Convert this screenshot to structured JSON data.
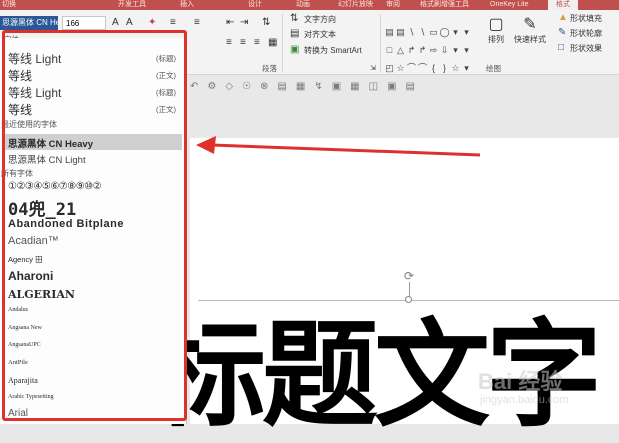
{
  "tabs": [
    {
      "label": "切换",
      "active": false
    },
    {
      "label": "开发工具",
      "active": false
    },
    {
      "label": "插入",
      "active": false
    },
    {
      "label": "设计",
      "active": false
    },
    {
      "label": "动画",
      "active": false
    },
    {
      "label": "幻灯片放映",
      "active": false
    },
    {
      "label": "审阅",
      "active": false
    },
    {
      "label": "格式刷增强工具",
      "active": false
    },
    {
      "label": "OneKey Lite",
      "active": false
    },
    {
      "label": "格式",
      "active": true
    }
  ],
  "ribbon": {
    "font_name": "思源黑体 CN He",
    "font_size": "166",
    "text_direction": "文字方向",
    "align_text": "对齐文本",
    "convert_smartart": "转换为 SmartArt",
    "paragraph_group": "段落",
    "drawing_group": "绘图",
    "arrange": "排列",
    "quick_styles": "快速样式",
    "shape_fill": "形状填充",
    "shape_outline": "形状轮廓",
    "shape_effects": "形状效果",
    "font_group_partial": "字体"
  },
  "font_panel": {
    "theme_fonts": [
      {
        "name": "等线 Light",
        "tag": "(标题)"
      },
      {
        "name": "等线",
        "tag": "(正文)"
      },
      {
        "name": "等线 Light",
        "tag": "(标题)"
      },
      {
        "name": "等线",
        "tag": "(正文)"
      }
    ],
    "recent_header": "最近使用的字体",
    "recent_fonts": [
      "思源黑体 CN Heavy",
      "思源黑体 CN Light"
    ],
    "all_header": "所有字体",
    "all_fonts": [
      "①②③④⑤⑥⑦⑧⑨⑩②",
      "04兜_21",
      "Abandoned Bitplane",
      "Acadian™",
      "Agency 田",
      "Aharoni",
      "ALGERIAN",
      "Andalus",
      "Angsana New",
      "AngsanaUPC",
      "AntPile",
      "Aparajita",
      "Arabic Typesetting",
      "Arial"
    ]
  },
  "slide": {
    "title_text": "标题文字"
  },
  "watermark": {
    "brand": "Bai 经验",
    "url": "jingyan.baidu.com"
  },
  "colors": {
    "tab_bar": "#c0504d",
    "highlight_box": "#e0302c",
    "selected_font_row": "#d0d0d0"
  }
}
